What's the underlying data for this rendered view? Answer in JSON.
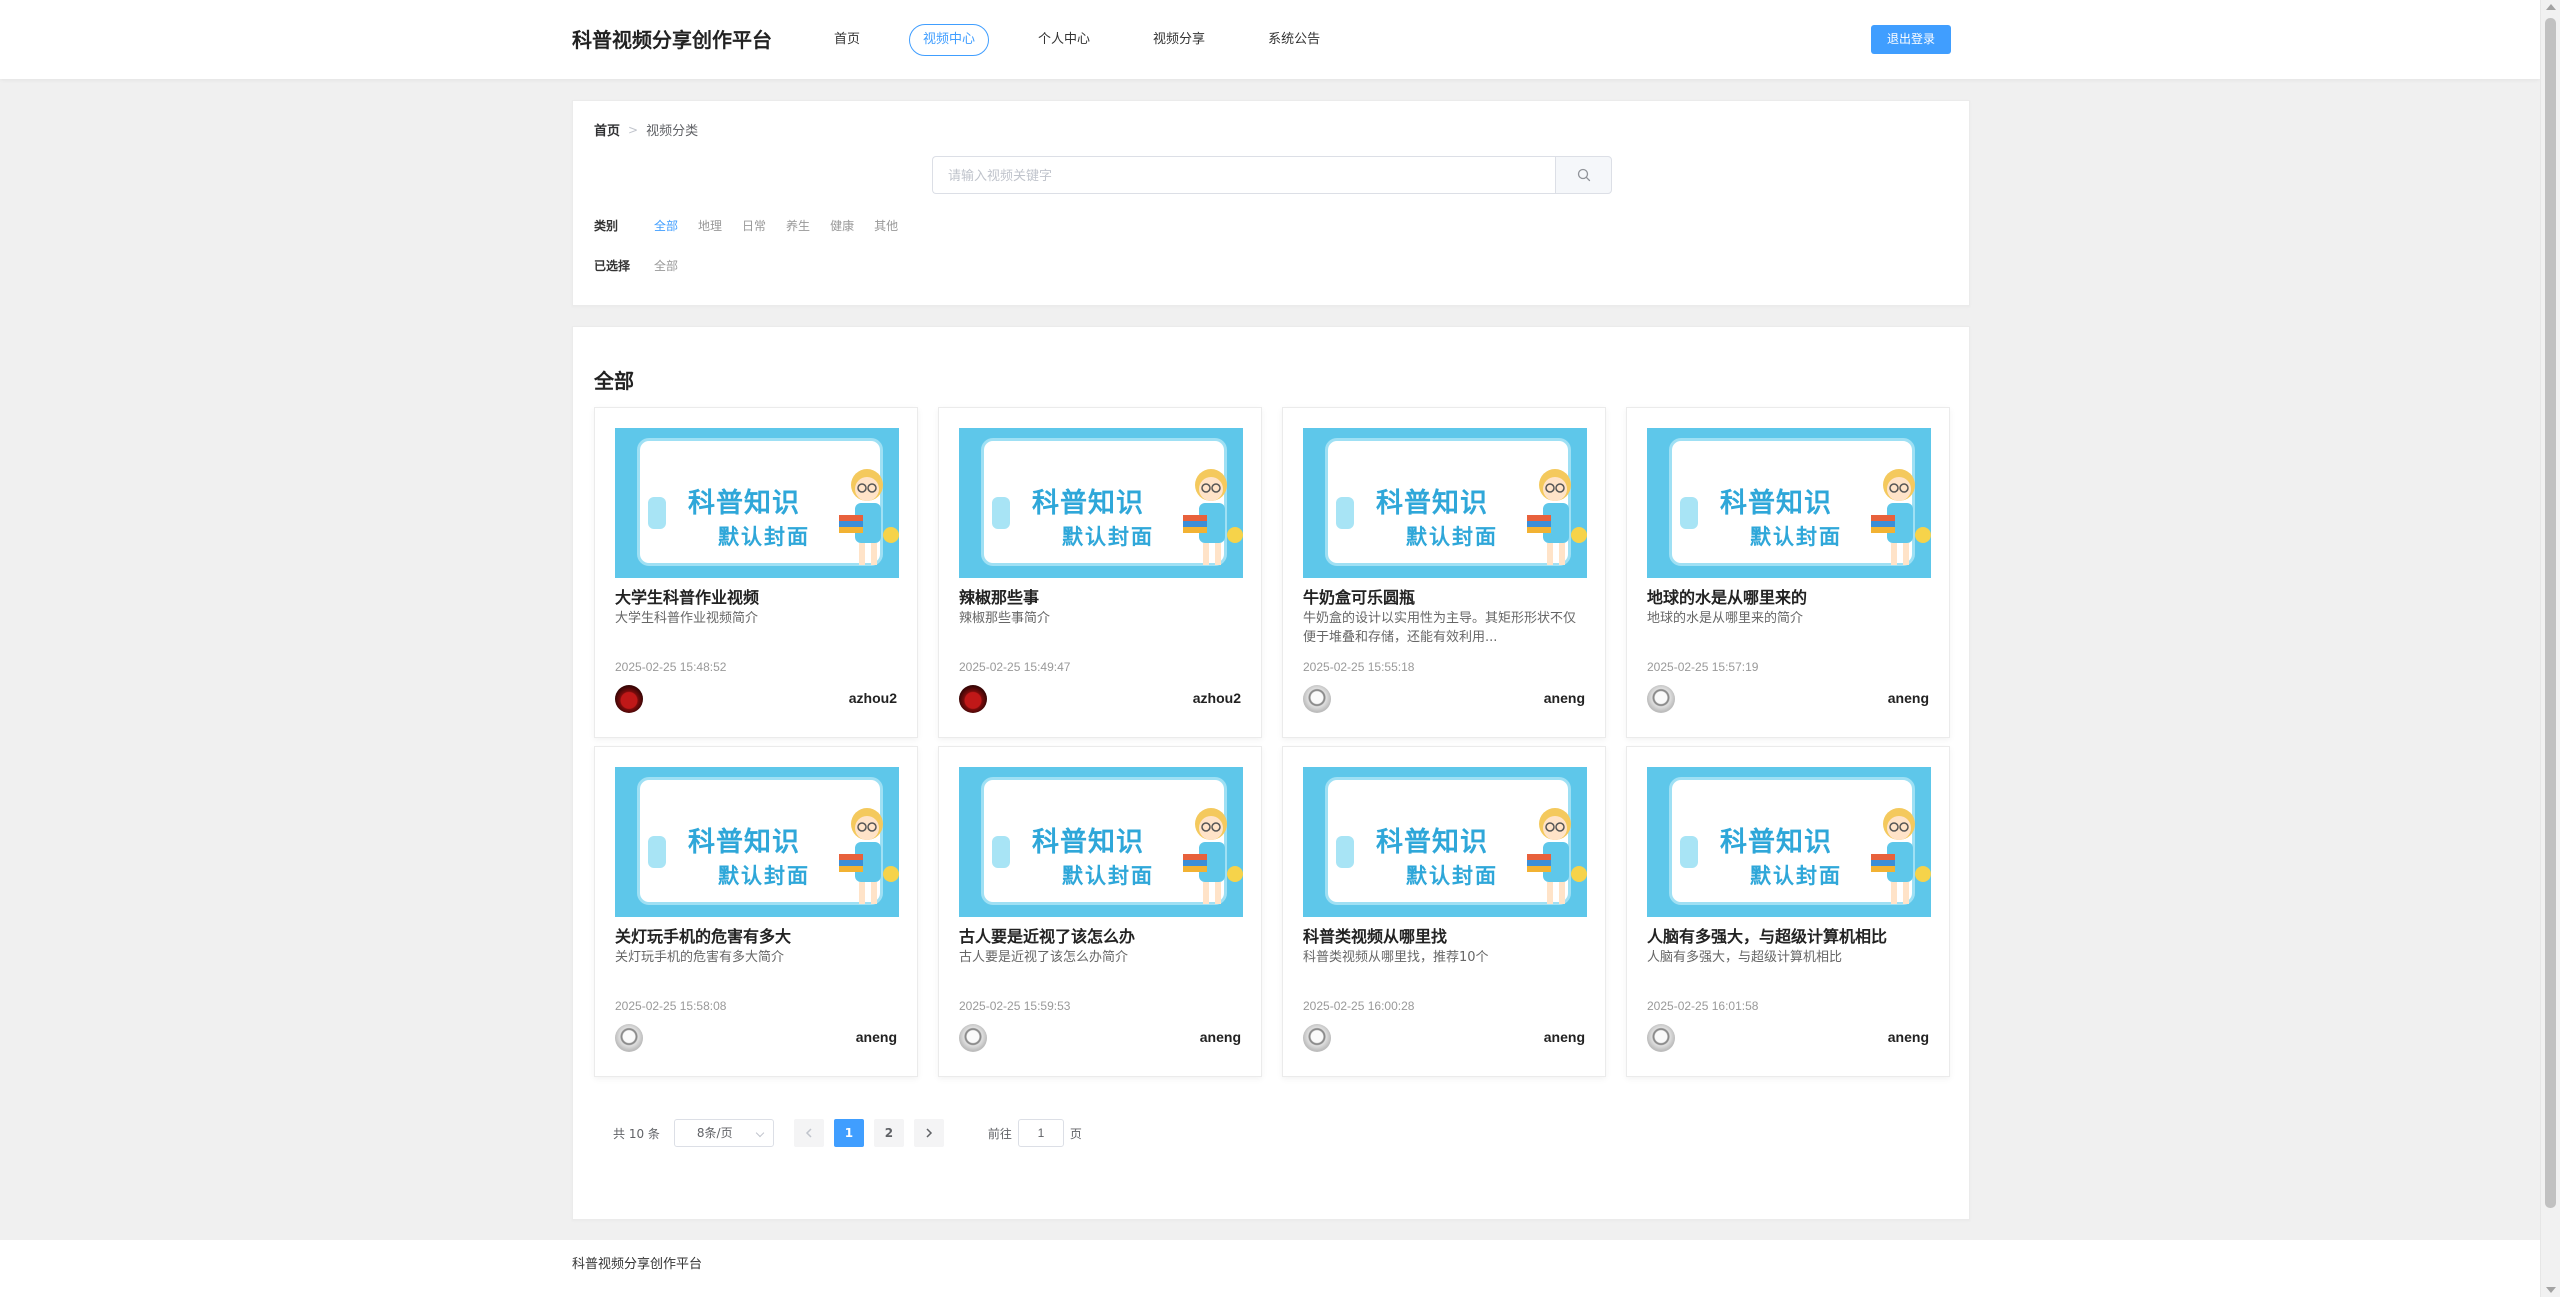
{
  "brand": "科普视频分享创作平台",
  "nav": [
    {
      "label": "首页",
      "active": false
    },
    {
      "label": "视频中心",
      "active": true
    },
    {
      "label": "个人中心",
      "active": false
    },
    {
      "label": "视频分享",
      "active": false
    },
    {
      "label": "系统公告",
      "active": false
    }
  ],
  "logout_label": "退出登录",
  "breadcrumb": {
    "home": "首页",
    "current": "视频分类"
  },
  "search": {
    "placeholder": "请输入视频关键字",
    "value": ""
  },
  "filter": {
    "category_label": "类别",
    "options": [
      "全部",
      "地理",
      "日常",
      "养生",
      "健康",
      "其他"
    ],
    "active_option": "全部",
    "selected_label": "已选择",
    "selected_value": "全部"
  },
  "section_title": "全部",
  "thumbnail": {
    "line1": "科普知识",
    "line2": "默认封面"
  },
  "videos": [
    {
      "title": "大学生科普作业视频",
      "desc": "大学生科普作业视频简介",
      "date": "2025-02-25 15:48:52",
      "author": "azhou2",
      "avatar": "red"
    },
    {
      "title": "辣椒那些事",
      "desc": "辣椒那些事简介",
      "date": "2025-02-25 15:49:47",
      "author": "azhou2",
      "avatar": "red"
    },
    {
      "title": "牛奶盒可乐圆瓶",
      "desc": "牛奶盒的设计以实用性为主导。其矩形形状不仅便于堆叠和存储，还能有效利用...",
      "date": "2025-02-25 15:55:18",
      "author": "aneng",
      "avatar": "grey"
    },
    {
      "title": "地球的水是从哪里来的",
      "desc": "地球的水是从哪里来的简介",
      "date": "2025-02-25 15:57:19",
      "author": "aneng",
      "avatar": "grey"
    },
    {
      "title": "关灯玩手机的危害有多大",
      "desc": "关灯玩手机的危害有多大简介",
      "date": "2025-02-25 15:58:08",
      "author": "aneng",
      "avatar": "grey"
    },
    {
      "title": "古人要是近视了该怎么办",
      "desc": "古人要是近视了该怎么办简介",
      "date": "2025-02-25 15:59:53",
      "author": "aneng",
      "avatar": "grey"
    },
    {
      "title": "科普类视频从哪里找",
      "desc": "科普类视频从哪里找，推荐10个",
      "date": "2025-02-25 16:00:28",
      "author": "aneng",
      "avatar": "grey"
    },
    {
      "title": "人脑有多强大，与超级计算机相比",
      "desc": "人脑有多强大，与超级计算机相比",
      "date": "2025-02-25 16:01:58",
      "author": "aneng",
      "avatar": "grey"
    }
  ],
  "pagination": {
    "total_text": "共 10 条",
    "page_size": "8条/页",
    "pages": [
      "1",
      "2"
    ],
    "current_page": "1",
    "goto_prefix": "前往",
    "goto_value": "1",
    "goto_suffix": "页"
  },
  "footer_text": "科普视频分享创作平台"
}
